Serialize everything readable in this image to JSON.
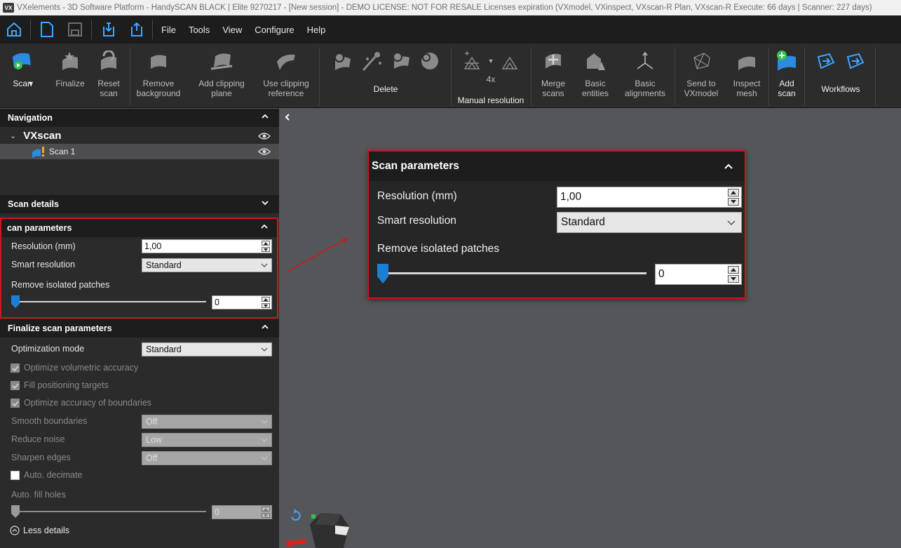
{
  "window": {
    "title": "VXelements - 3D Software Platform - HandySCAN BLACK | Elite 9270217 - [New session] - DEMO LICENSE: NOT FOR RESALE Licenses expiration (VXmodel, VXinspect, VXscan-R Plan, VXscan-R Execute: 66 days | Scanner: 227 days)",
    "logo_text": "VX"
  },
  "menu": {
    "items": [
      "File",
      "Tools",
      "View",
      "Configure",
      "Help"
    ]
  },
  "ribbon": {
    "scan": "Scan",
    "finalize": "Finalize",
    "reset_scan": "Reset\nscan",
    "remove_background": "Remove\nbackground",
    "add_clipping_plane": "Add clipping\nplane",
    "use_clipping_reference": "Use clipping\nreference",
    "delete": "Delete",
    "res_4x": "4x",
    "manual_resolution": "Manual resolution",
    "merge_scans": "Merge\nscans",
    "basic_entities": "Basic\nentities",
    "basic_alignments": "Basic\nalignments",
    "send_to_vxmodel": "Send to\nVXmodel",
    "inspect_mesh": "Inspect\nmesh",
    "add_scan": "Add\nscan",
    "workflows": "Workflows"
  },
  "navigation": {
    "title": "Navigation",
    "root": "VXscan",
    "child": "Scan 1"
  },
  "scan_details": {
    "title": "Scan details"
  },
  "scan_parameters": {
    "title": "Scan parameters",
    "title_clipped": "can parameters",
    "resolution_label": "Resolution (mm)",
    "resolution_value": "1,00",
    "smart_resolution_label": "Smart resolution",
    "smart_resolution_value": "Standard",
    "remove_isolated_label": "Remove isolated patches",
    "remove_isolated_value": "0",
    "remove_isolated_level": 0
  },
  "finalize_parameters": {
    "title": "Finalize scan parameters",
    "optimization_mode_label": "Optimization mode",
    "optimization_mode_value": "Standard",
    "optimize_volumetric": "Optimize volumetric accuracy",
    "fill_targets": "Fill positioning targets",
    "optimize_boundaries": "Optimize accuracy of boundaries",
    "smooth_boundaries_label": "Smooth boundaries",
    "smooth_boundaries_value": "Off",
    "reduce_noise_label": "Reduce noise",
    "reduce_noise_value": "Low",
    "sharpen_edges_label": "Sharpen edges",
    "sharpen_edges_value": "Off",
    "auto_decimate": "Auto. decimate",
    "auto_fill_holes_label": "Auto. fill holes",
    "auto_fill_holes_value": "0",
    "less_details": "Less details"
  },
  "colors": {
    "accent_blue": "#1b7fd6",
    "highlight_red": "#d0161c",
    "panel_bg": "#2b2b2b",
    "viewport_bg": "#555659"
  }
}
